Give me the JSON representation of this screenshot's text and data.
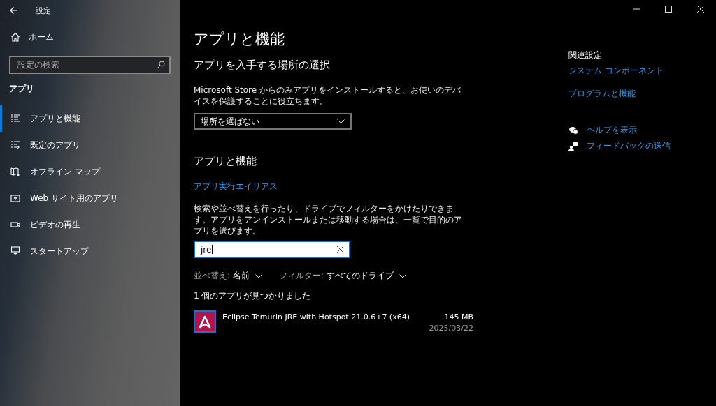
{
  "window": {
    "title": "設定"
  },
  "sidebar": {
    "home": "ホーム",
    "search": {
      "placeholder": "設定の検索"
    },
    "section": "アプリ",
    "items": [
      {
        "label": "アプリと機能",
        "selected": true
      },
      {
        "label": "既定のアプリ",
        "selected": false
      },
      {
        "label": "オフライン マップ",
        "selected": false
      },
      {
        "label": "Web サイト用のアプリ",
        "selected": false
      },
      {
        "label": "ビデオの再生",
        "selected": false
      },
      {
        "label": "スタートアップ",
        "selected": false
      }
    ]
  },
  "main": {
    "title": "アプリと機能",
    "source_heading": "アプリを入手する場所の選択",
    "source_description": "Microsoft Store からのみアプリをインストールすると、お使いのデバイスを保護することに役立ちます。",
    "source_dropdown": "場所を選ばない",
    "apps_heading": "アプリと機能",
    "alias_link": "アプリ実行エイリアス",
    "apps_description": "検索や並べ替えを行ったり、ドライブでフィルターをかけたりできます。アプリをアンインストールまたは移動する場合は、一覧で目的のアプリを選びます。",
    "search": {
      "value": "jre"
    },
    "sort": {
      "label": "並べ替え:",
      "value": "名前"
    },
    "filter": {
      "label": "フィルター:",
      "value": "すべてのドライブ"
    },
    "result_count": "1 個のアプリが見つかりました",
    "apps": [
      {
        "name": "Eclipse Temurin JRE with Hotspot 21.0.6+7 (x64)",
        "size": "145 MB",
        "date": "2025/03/22"
      }
    ]
  },
  "related": {
    "heading": "関連設定",
    "links": [
      "システム コンポーネント",
      "プログラムと機能"
    ],
    "help": [
      "ヘルプを表示",
      "フィードバックの送信"
    ]
  }
}
